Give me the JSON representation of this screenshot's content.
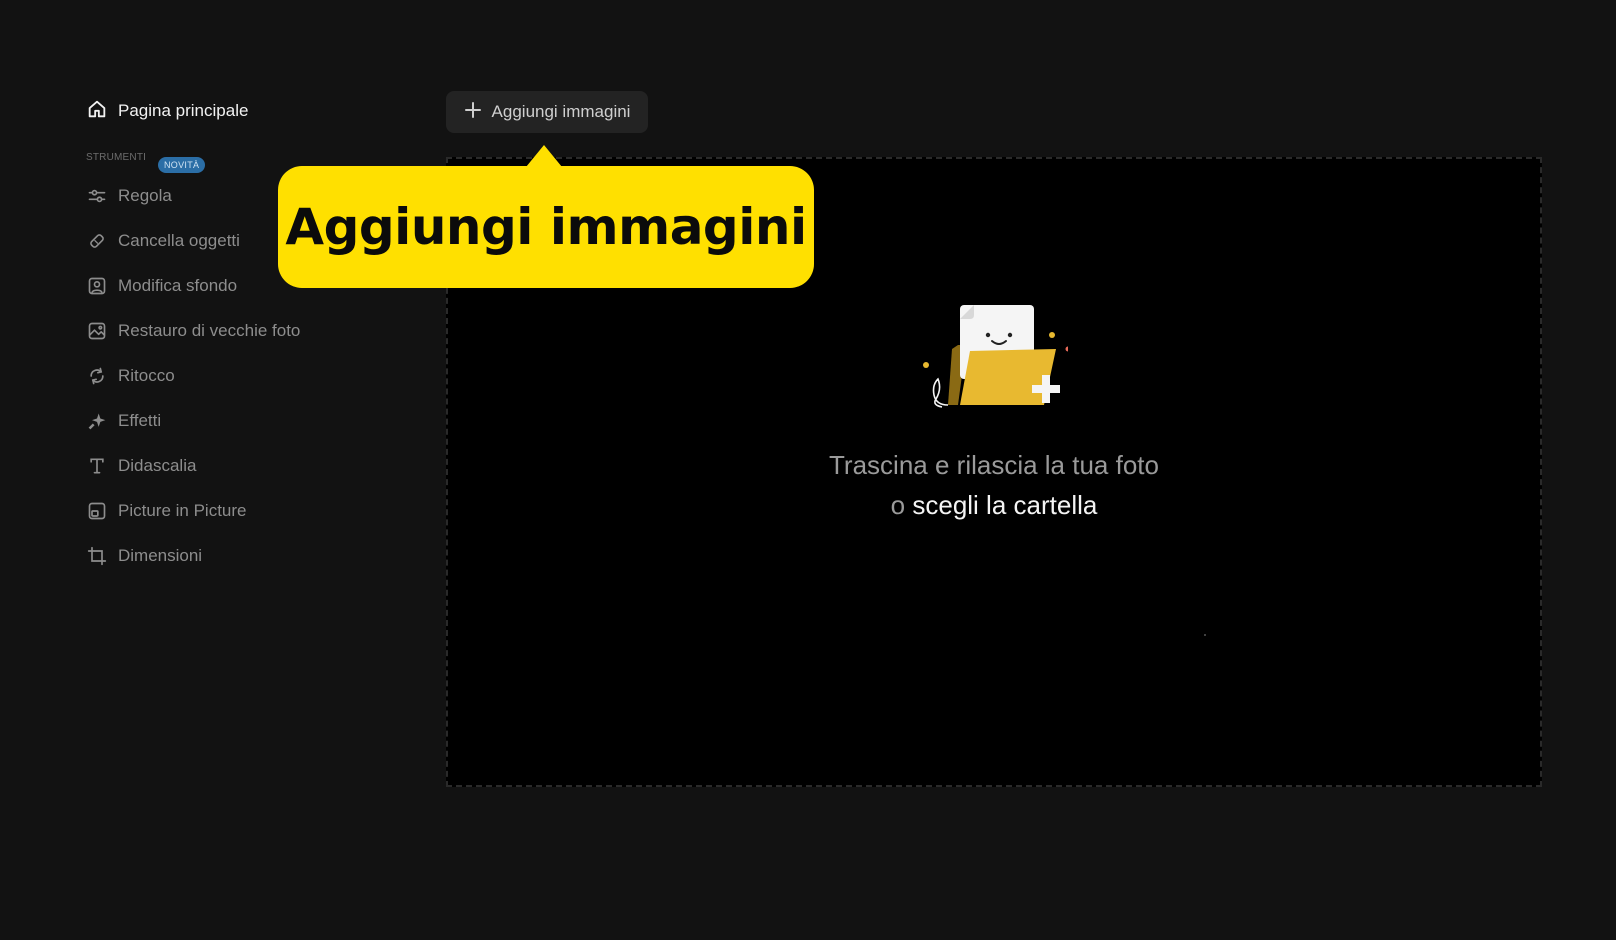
{
  "sidebar": {
    "home_label": "Pagina principale",
    "section_label": "STRUMENTI",
    "new_badge": "NOVITÀ",
    "tools": [
      {
        "label": "Regola",
        "icon": "sliders-icon"
      },
      {
        "label": "Cancella oggetti",
        "icon": "eraser-icon"
      },
      {
        "label": "Modifica sfondo",
        "icon": "portrait-icon"
      },
      {
        "label": "Restauro di vecchie foto",
        "icon": "photo-icon"
      },
      {
        "label": "Ritocco",
        "icon": "retouch-icon"
      },
      {
        "label": "Effetti",
        "icon": "sparkle-icon"
      },
      {
        "label": "Didascalia",
        "icon": "text-icon"
      },
      {
        "label": "Picture in Picture",
        "icon": "pip-icon"
      },
      {
        "label": "Dimensioni",
        "icon": "crop-icon"
      }
    ]
  },
  "toolbar": {
    "add_images_label": "Aggiungi immagini"
  },
  "dropzone": {
    "line1": "Trascina e rilascia la tua foto",
    "line2_prefix": "o",
    "line2_link": "scegli la cartella"
  },
  "callout": {
    "text": "Aggiungi immagini"
  },
  "colors": {
    "background": "#121212",
    "dropzone": "#000000",
    "callout": "#ffe000",
    "badge": "#2b6ea6",
    "folder": "#e8b930"
  }
}
